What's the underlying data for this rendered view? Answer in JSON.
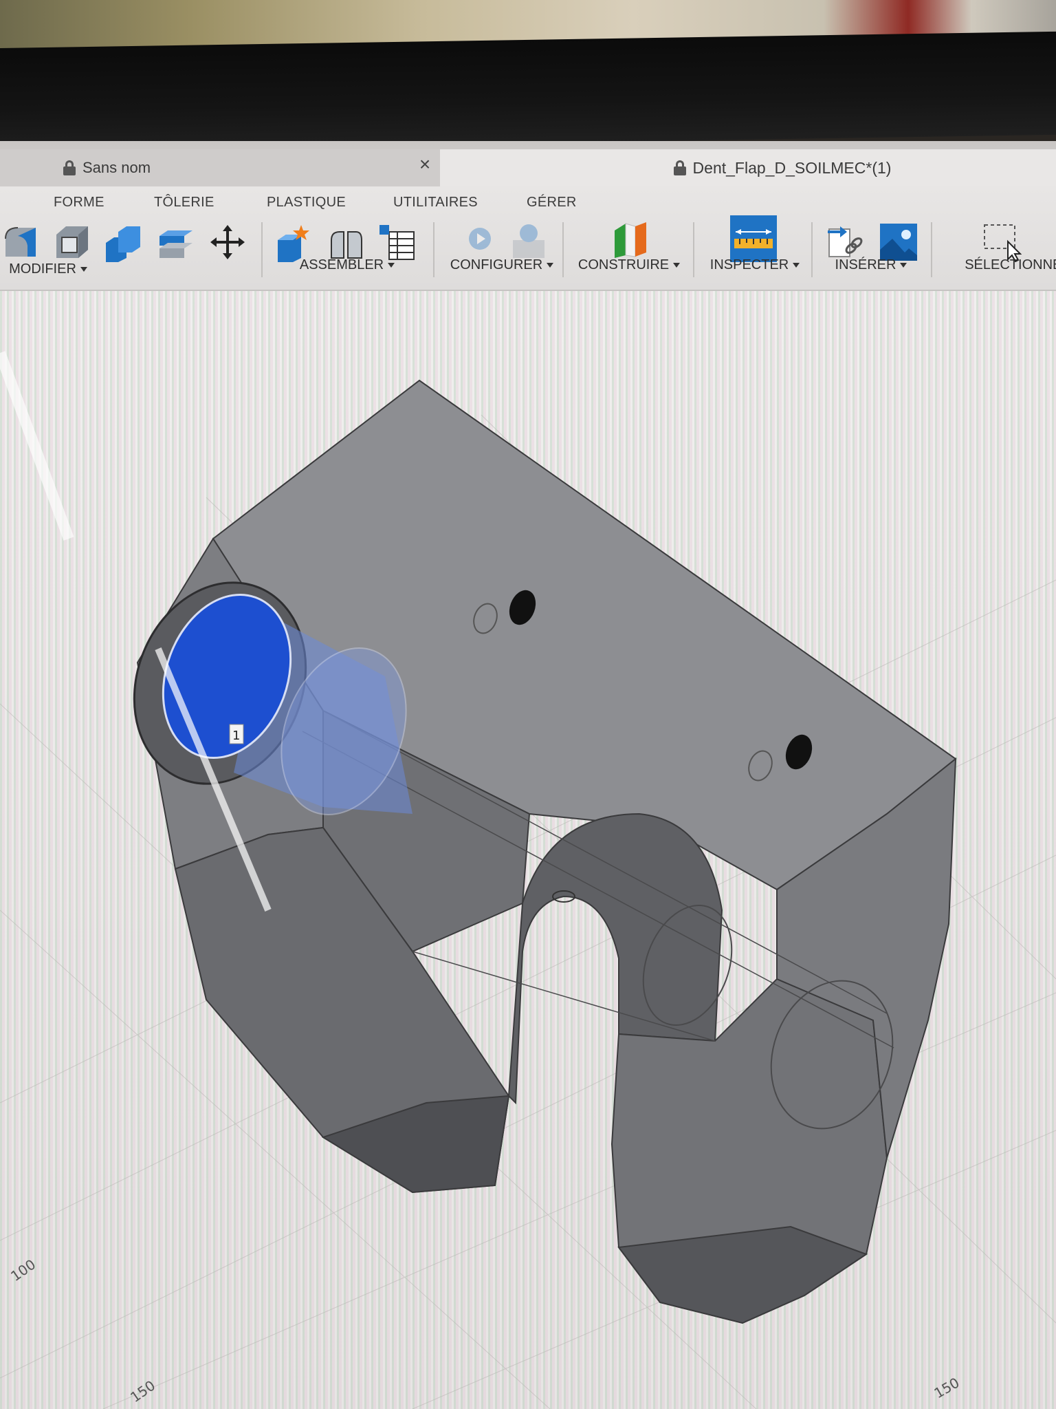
{
  "tabs": {
    "inactive": {
      "title": "Sans nom",
      "close": "×"
    },
    "active": {
      "title": "Dent_Flap_D_SOILMEC*(1)"
    }
  },
  "menu_tabs": [
    "FORME",
    "TÔLERIE",
    "PLASTIQUE",
    "UTILITAIRES",
    "GÉRER"
  ],
  "groups": {
    "modifier": "MODIFIER",
    "assembler": "ASSEMBLER",
    "configurer": "CONFIGURER",
    "construire": "CONSTRUIRE",
    "inspecter": "INSPECTER",
    "inserer": "INSÉRER",
    "selectionner": "SÉLECTIONNER"
  },
  "viewport": {
    "selection_badge": "1",
    "axis_labels": [
      "100",
      "150",
      "150"
    ]
  },
  "icons": [
    "fillet-icon",
    "shell-icon",
    "combine-icon",
    "offset-face-icon",
    "move-icon",
    "new-component-icon",
    "joint-icon",
    "bom-icon",
    "parameter-icon",
    "change-parameter-icon",
    "plane-icon",
    "measure-icon",
    "insert-derive-icon",
    "insert-image-icon",
    "select-window-icon"
  ],
  "colors": {
    "accent_blue": "#1f73c4",
    "selection_blue": "#1d4fd0",
    "body_gray": "#7c7d80"
  }
}
